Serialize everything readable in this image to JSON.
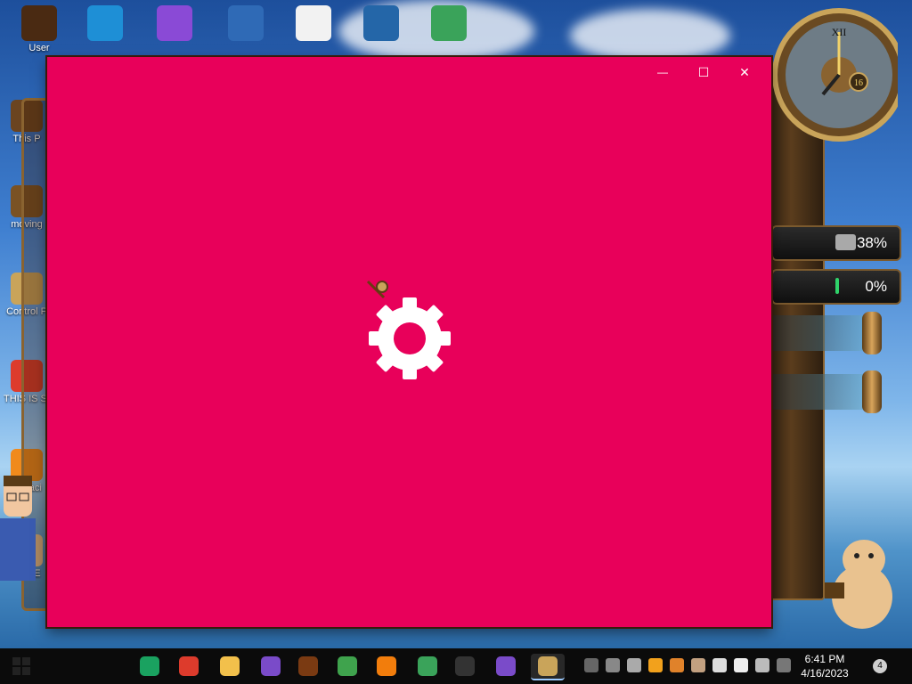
{
  "desktop": {
    "icons_top": [
      {
        "name": "desktop-icon-user",
        "label": "User",
        "color": "#4a2a12"
      },
      {
        "name": "desktop-icon-edge",
        "label": "",
        "color": "#1e8fd6"
      },
      {
        "name": "desktop-icon-visual-studio",
        "label": "",
        "color": "#8a4ad6"
      },
      {
        "name": "desktop-icon-virtualbox",
        "label": "",
        "color": "#2f6ab6"
      },
      {
        "name": "desktop-icon-hxd",
        "label": "",
        "color": "#f2f2f2"
      },
      {
        "name": "desktop-icon-spy-hat",
        "label": "",
        "color": "#2466a8"
      },
      {
        "name": "desktop-icon-monitor",
        "label": "",
        "color": "#3aa35a"
      }
    ],
    "icons_left": [
      {
        "name": "desktop-icon-this-pc",
        "label": "This P",
        "color": "#6b4420"
      },
      {
        "name": "desktop-icon-moving",
        "label": "moving",
        "color": "#7a5224"
      },
      {
        "name": "desktop-icon-control-panel",
        "label": "Control P",
        "color": "#c9a45a"
      },
      {
        "name": "desktop-icon-chrome",
        "label": "THIS IS SPYWA",
        "color": "#dd3b2c"
      },
      {
        "name": "desktop-icon-audacity",
        "label": "Audaci",
        "color": "#f08a1c"
      },
      {
        "name": "desktop-icon-under",
        "label": "UNDE",
        "color": "#e9c28f"
      }
    ]
  },
  "widgets": {
    "meter_1": {
      "value_text": "38%",
      "fill_fraction": 0.38,
      "color": "#a9a9a9"
    },
    "meter_2": {
      "value_text": "0%",
      "fill_fraction": 0.05,
      "color": "#2fd36a"
    },
    "clock_day": "16"
  },
  "window": {
    "background": "#e8005a",
    "minimize_label": "—",
    "maximize_label": "☐",
    "close_label": "✕"
  },
  "taskbar": {
    "apps": [
      {
        "name": "taskbar-google-chat",
        "color": "#1aa260"
      },
      {
        "name": "taskbar-chrome",
        "color": "#dd3b2c"
      },
      {
        "name": "taskbar-file-explorer",
        "color": "#f2c04b"
      },
      {
        "name": "taskbar-bonzi",
        "color": "#7a4bc9"
      },
      {
        "name": "taskbar-app-brown",
        "color": "#7a3a12"
      },
      {
        "name": "taskbar-windows-flag",
        "color": "#3fa34d"
      },
      {
        "name": "taskbar-vlc",
        "color": "#f27d0c"
      },
      {
        "name": "taskbar-remote-desktop",
        "color": "#3aa35a"
      },
      {
        "name": "taskbar-cat-app",
        "color": "#333333"
      },
      {
        "name": "taskbar-bonzi-2",
        "color": "#7a4bc9"
      },
      {
        "name": "taskbar-active-window",
        "color": "#c9a45a"
      }
    ],
    "time": "6:41 PM",
    "date": "4/16/2023",
    "notification_count": "4"
  }
}
